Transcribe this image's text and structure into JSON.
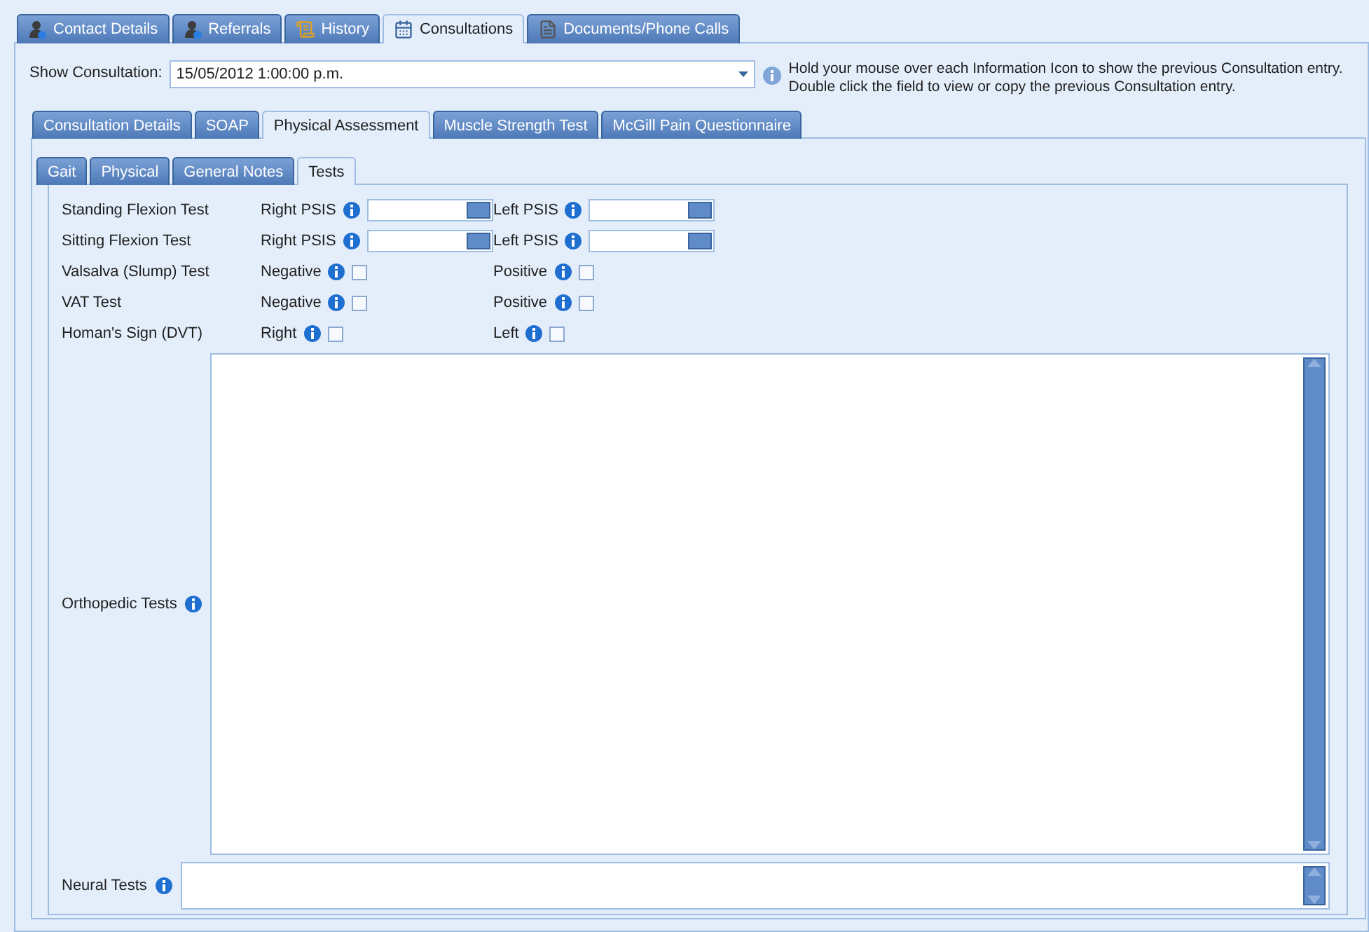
{
  "main_tabs": [
    {
      "label": "Contact Details",
      "kind": "person",
      "selected": false
    },
    {
      "label": "Referrals",
      "kind": "person",
      "selected": false
    },
    {
      "label": "History",
      "kind": "scroll",
      "selected": false
    },
    {
      "label": "Consultations",
      "kind": "calendar",
      "selected": true
    },
    {
      "label": "Documents/Phone Calls",
      "kind": "document",
      "selected": false
    }
  ],
  "show_consultation": {
    "label": "Show Consultation:",
    "value": "15/05/2012 1:00:00 p.m."
  },
  "hint": [
    "Hold your mouse over each Information Icon to show the previous Consultation entry.",
    "Double click the field to view or copy the previous Consultation entry."
  ],
  "section_tabs": [
    {
      "label": "Consultation Details",
      "selected": false
    },
    {
      "label": "SOAP",
      "selected": false
    },
    {
      "label": "Physical Assessment",
      "selected": true
    },
    {
      "label": "Muscle Strength Test",
      "selected": false
    },
    {
      "label": "McGill Pain Questionnaire",
      "selected": false
    }
  ],
  "assessment_tabs": [
    {
      "label": "Gait",
      "selected": false
    },
    {
      "label": "Physical",
      "selected": false
    },
    {
      "label": "General Notes",
      "selected": false
    },
    {
      "label": "Tests",
      "selected": true
    }
  ],
  "tests": [
    {
      "label": "Standing Flexion Test",
      "kind": "field",
      "left": {
        "label": "Right PSIS"
      },
      "right": {
        "label": "Left PSIS"
      }
    },
    {
      "label": "Sitting Flexion Test",
      "kind": "field",
      "left": {
        "label": "Right PSIS"
      },
      "right": {
        "label": "Left PSIS"
      }
    },
    {
      "label": "Valsalva (Slump) Test",
      "kind": "check",
      "left": {
        "label": "Negative",
        "checked": false
      },
      "right": {
        "label": "Positive",
        "checked": false
      }
    },
    {
      "label": "VAT Test",
      "kind": "check",
      "left": {
        "label": "Negative",
        "checked": false
      },
      "right": {
        "label": "Positive",
        "checked": false
      }
    },
    {
      "label": "Homan's Sign (DVT)",
      "kind": "check",
      "left": {
        "label": "Right",
        "checked": false
      },
      "right": {
        "label": "Left",
        "checked": false
      }
    }
  ],
  "orthopedic_tests": {
    "label": "Orthopedic Tests"
  },
  "neural_tests": {
    "label": "Neural Tests"
  }
}
